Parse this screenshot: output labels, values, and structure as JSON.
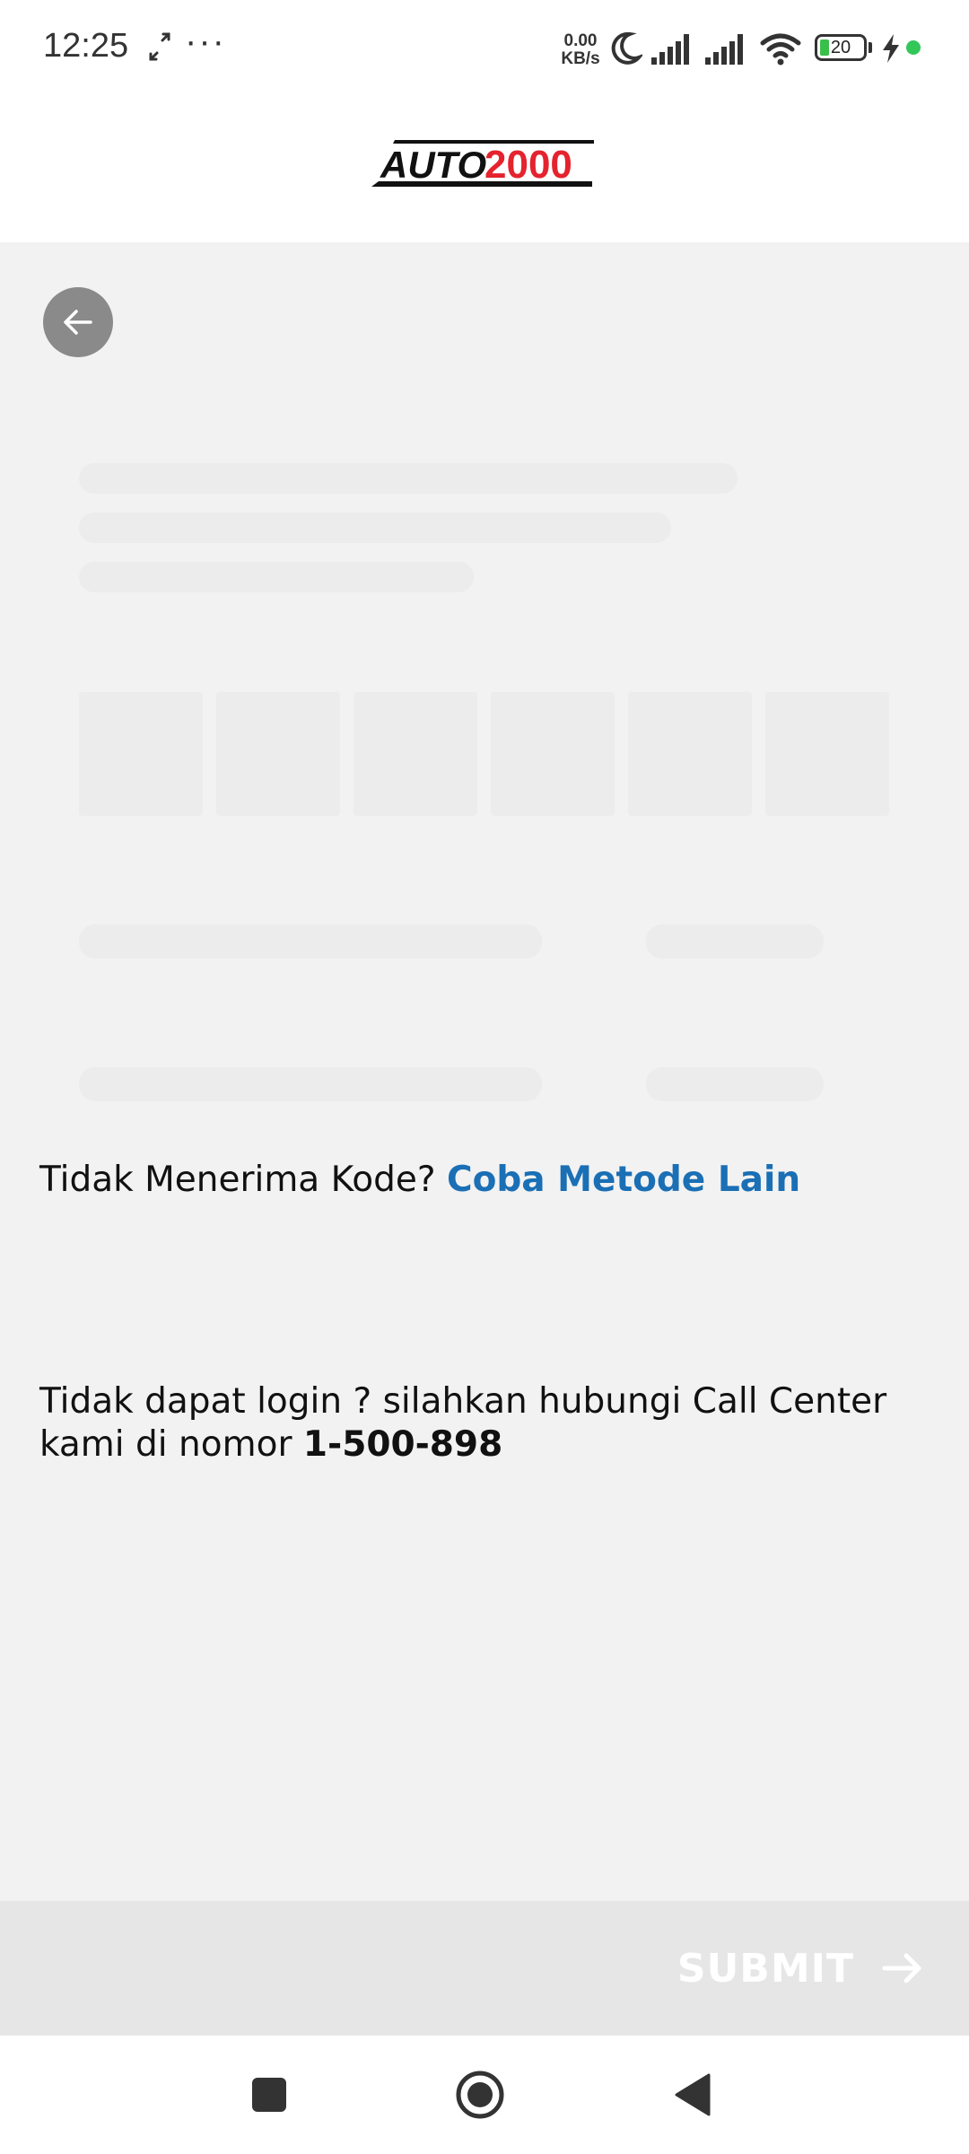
{
  "status_bar": {
    "time": "12:25",
    "more": "···",
    "net_speed_value": "0.00",
    "net_speed_unit": "KB/s",
    "battery_level": "20",
    "icons": [
      "expand-icon",
      "moon-icon",
      "signal-icon",
      "signal-icon",
      "wifi-icon",
      "battery-icon",
      "charging-icon",
      "green-dot-indicator"
    ]
  },
  "header": {
    "logo_text_left": "AUTO",
    "logo_text_right": "2000"
  },
  "otp": {
    "resend_question": "Tidak Menerima Kode? ",
    "resend_link": "Coba Metode Lain"
  },
  "help": {
    "text": "Tidak dapat login ? silahkan hubungi Call Center kami di nomor ",
    "phone": "1-500-898"
  },
  "footer": {
    "submit_label": "SUBMIT"
  },
  "colors": {
    "background": "#f2f2f2",
    "link": "#1a6fb5",
    "logo_red": "#e4232e",
    "submit_bar": "#e6e6e6"
  }
}
